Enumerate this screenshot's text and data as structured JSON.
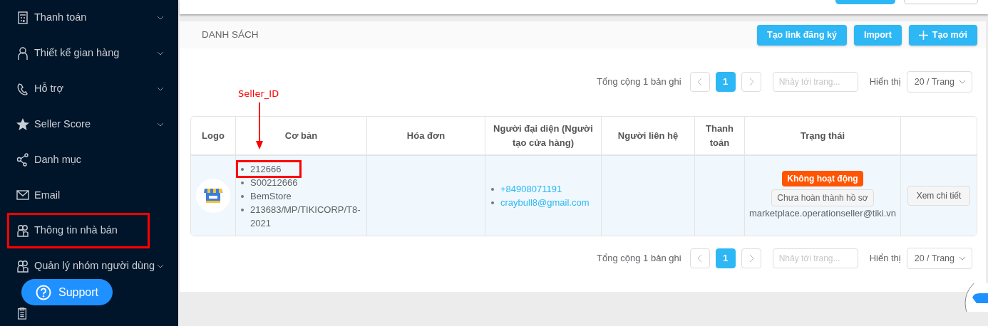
{
  "sidebar": {
    "items": [
      {
        "label": "Thanh toán",
        "has_submenu": true,
        "highlighted": false
      },
      {
        "label": "Thiết kế gian hàng",
        "has_submenu": true,
        "highlighted": false
      },
      {
        "label": "Hỗ trợ",
        "has_submenu": true,
        "highlighted": false
      },
      {
        "label": "Seller Score",
        "has_submenu": true,
        "highlighted": false
      },
      {
        "label": "Danh mục",
        "has_submenu": false,
        "highlighted": false
      },
      {
        "label": "Email",
        "has_submenu": false,
        "highlighted": false
      },
      {
        "label": "Thông tin nhà bán",
        "has_submenu": false,
        "highlighted": true
      },
      {
        "label": "Quản lý nhóm người dùng",
        "has_submenu": true,
        "highlighted": false
      },
      {
        "has_submenu": false,
        "highlighted": false
      }
    ],
    "support_button": {
      "label": "Support"
    }
  },
  "top_bar": {
    "buttons": [
      {
        "kind": "primary"
      },
      {
        "kind": "default"
      }
    ]
  },
  "list_panel": {
    "title": "DANH SÁCH",
    "buttons": [
      {
        "label": "Tạo link đăng ký",
        "kind": "plain"
      },
      {
        "label": "Import",
        "kind": "plain"
      },
      {
        "label": "Tạo mới",
        "kind": "add"
      }
    ]
  },
  "pagination_top": {
    "total": "Tổng cộng 1 bản ghi",
    "pages": [
      {
        "label": "1",
        "selected": true
      }
    ],
    "jump_placeholder": "Nhảy tới trang...",
    "page_size_label": "Hiển thị",
    "page_size": "20 / Trang"
  },
  "annotation": {
    "label": "Seller_ID"
  },
  "table": {
    "columns": [
      "Logo",
      "Cơ bản",
      "Hóa đơn",
      "Người đại diện (Người tạo cửa hàng)",
      "Người liên hệ",
      "Thanh toán",
      "Trạng thái"
    ],
    "rows": [
      {
        "basic": [
          {
            "text": "212666",
            "highlighted": true
          },
          {
            "text": "S00212666",
            "highlighted": false
          },
          {
            "text": "BemStore",
            "highlighted": false
          },
          {
            "text": "213683/MP/TIKICORP/T8-2021",
            "highlighted": false
          }
        ],
        "representative": [
          "+84908071191",
          "craybull8@gmail.com"
        ],
        "status": {
          "badge": "Không hoạt động",
          "tag": "Chưa hoàn thành hồ sơ",
          "email": "marketplace.operationseller@tiki.vn"
        },
        "action": "Xem chi tiết"
      }
    ]
  },
  "pagination_bottom": {
    "total": "Tổng cộng 1 bản ghi",
    "pages": [
      {
        "label": "1",
        "selected": true
      }
    ],
    "jump_placeholder": "Nhảy tới trang...",
    "page_size_label": "Hiển thị",
    "page_size": "20 / Trang"
  }
}
